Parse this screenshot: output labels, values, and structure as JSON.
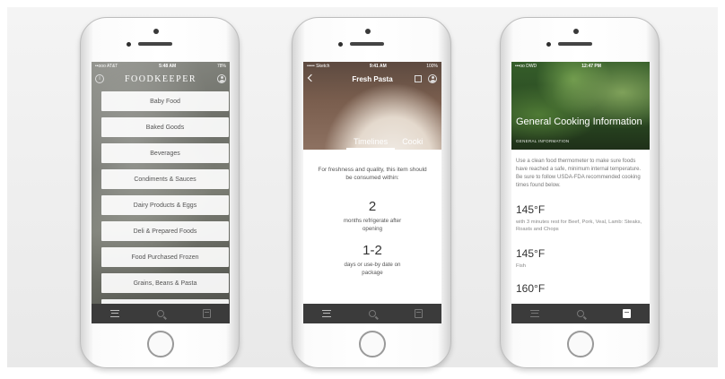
{
  "phone1": {
    "status": {
      "carrier": "••ooo AT&T",
      "time": "5:48 AM",
      "battery": "78%"
    },
    "brand": "FOODKEEPER",
    "info_glyph": "i",
    "categories": [
      "Baby Food",
      "Baked Goods",
      "Beverages",
      "Condiments & Sauces",
      "Dairy Products & Eggs",
      "Deli & Prepared Foods",
      "Food Purchased Frozen",
      "Grains, Beans & Pasta"
    ],
    "tabs": [
      "list-icon",
      "search-icon",
      "calendar-icon"
    ]
  },
  "phone2": {
    "status": {
      "carrier": "••••• Sketch",
      "time": "9:41 AM",
      "battery": "100%"
    },
    "title": "Fresh Pasta",
    "tabs": {
      "active": "Timelines",
      "next": "Cooki"
    },
    "intro": "For freshness and quality, this item should be consumed within:",
    "entries": [
      {
        "value": "2",
        "desc": "months refrigerate after opening"
      },
      {
        "value": "1-2",
        "desc": "days or use-by date on package"
      }
    ]
  },
  "phone3": {
    "status": {
      "carrier": "•••oo DWD",
      "time": "12:47 PM",
      "battery": ""
    },
    "title": "General Cooking Information",
    "subtitle": "GENERAL INFORMATION",
    "paragraph": "Use a clean food thermometer to make sure foods have reached a safe, minimum internal temperature. Be sure to follow USDA-FDA recommended cooking times found below.",
    "temps": [
      {
        "temp": "145°F",
        "note": "with 3 minutes rest for Beef, Pork, Veal, Lamb: Steaks, Roasts and Chops"
      },
      {
        "temp": "145°F",
        "note": "Fish"
      },
      {
        "temp": "160°F",
        "note": ""
      }
    ]
  }
}
